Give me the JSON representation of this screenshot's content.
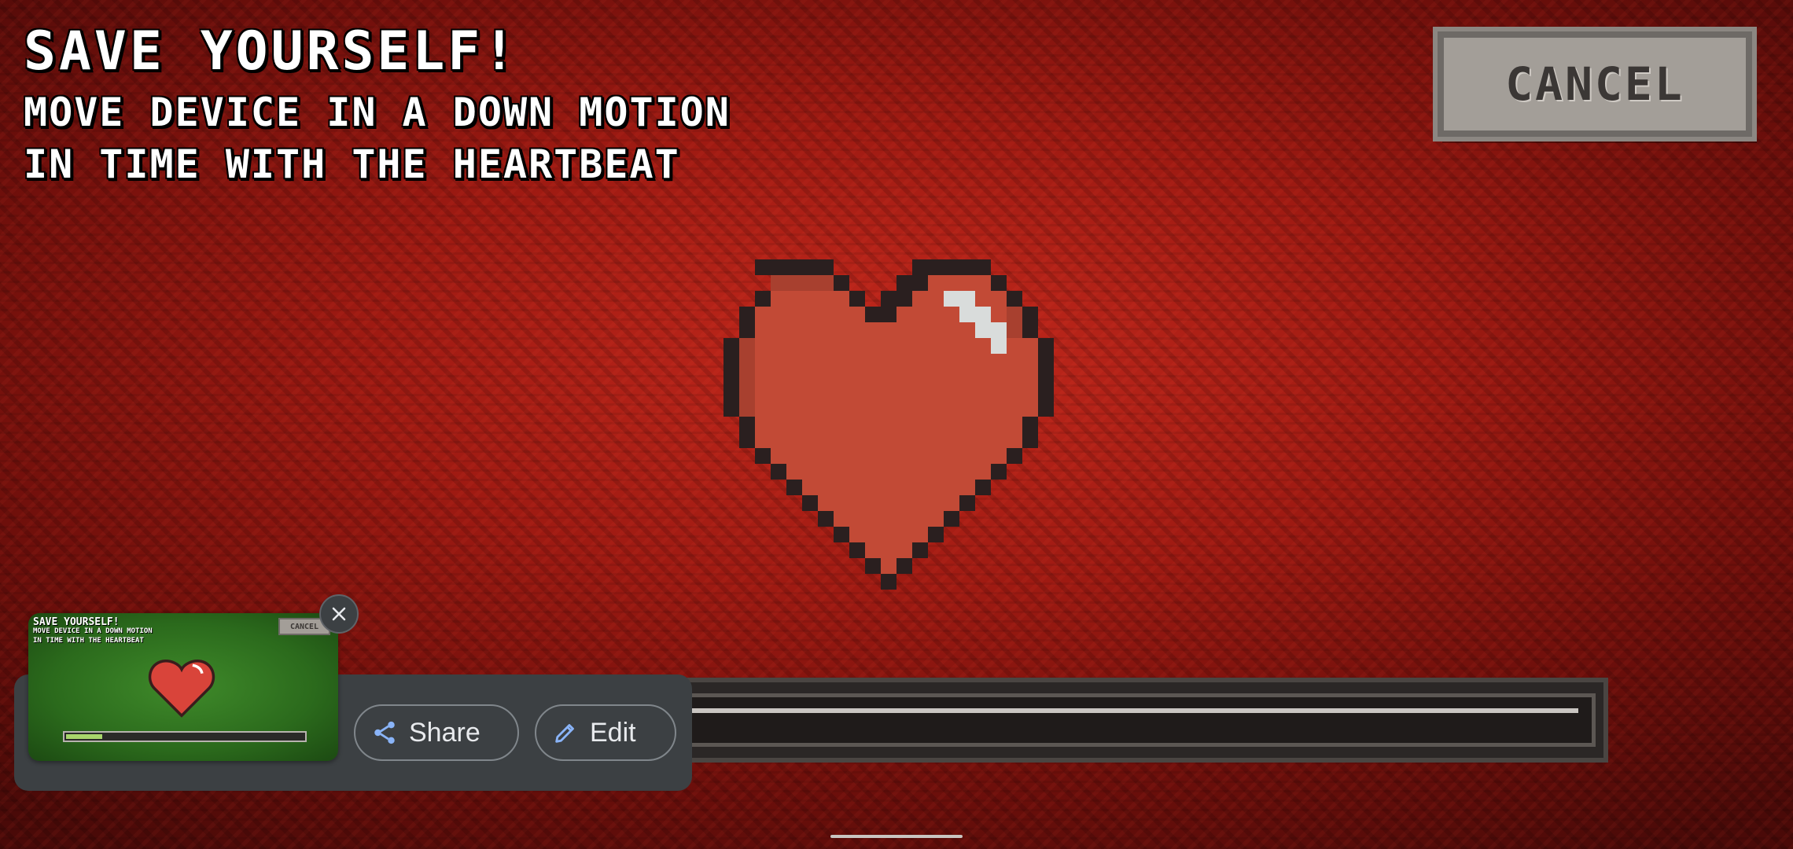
{
  "game": {
    "title": "SAVE YOURSELF!",
    "instruction_line1": "MOVE DEVICE IN A DOWN MOTION",
    "instruction_line2": "IN TIME WITH THE HEARTBEAT",
    "cancel_label": "CANCEL",
    "heartbeat_progress": 0.985,
    "colors": {
      "background": "#9e1a12",
      "heart": "#c0392b",
      "heart_outline": "#2a1f1f",
      "cancel_button": "#a39e98"
    }
  },
  "screenshot_preview": {
    "thumbnail": {
      "title": "SAVE YOURSELF!",
      "instruction_line1": "MOVE DEVICE IN A DOWN MOTION",
      "instruction_line2": "IN TIME WITH THE HEARTBEAT",
      "cancel_label": "CANCEL",
      "progress": 0.15
    },
    "close_icon": "close-icon",
    "share_label": "Share",
    "share_icon": "share-icon",
    "edit_label": "Edit",
    "edit_icon": "pencil-icon"
  }
}
